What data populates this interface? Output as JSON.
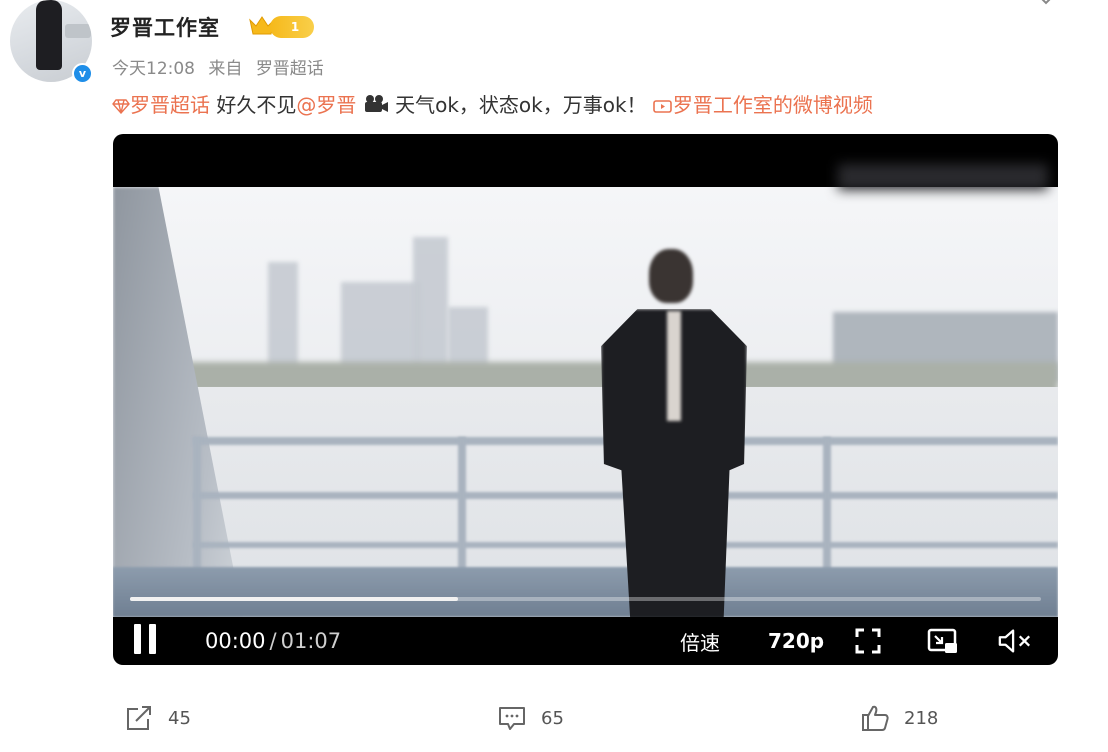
{
  "user": {
    "name": "罗晋工作室",
    "level": "1",
    "verified_mark": "v"
  },
  "meta": {
    "time": "今天12:08",
    "source_prefix": "来自",
    "source": "罗晋超话"
  },
  "content": {
    "tag": "罗晋超话",
    "text_before_mention": "好久不见",
    "mention": "@罗晋",
    "text_after_icon": "天气ok，状态ok，万事ok！",
    "video_link": "罗晋工作室的微博视频"
  },
  "video": {
    "current_time": "00:00",
    "separator": "/",
    "duration": "01:07",
    "progress_buffered": 0.36,
    "progress_played": 0.01,
    "speed_label": "倍速",
    "quality_label": "720p"
  },
  "footer": {
    "share_count": "45",
    "comment_count": "65",
    "like_count": "218"
  },
  "icons": {
    "crown": "crown-icon",
    "pause": "pause-icon",
    "fullscreen": "fullscreen-icon",
    "pip": "picture-in-picture-icon",
    "mute": "mute-icon",
    "share": "share-icon",
    "comment": "comment-icon",
    "like": "thumbs-up-icon"
  },
  "colors": {
    "link": "#eb7350",
    "level_badge": "#f6b91b",
    "verified": "#1f8ee8"
  }
}
